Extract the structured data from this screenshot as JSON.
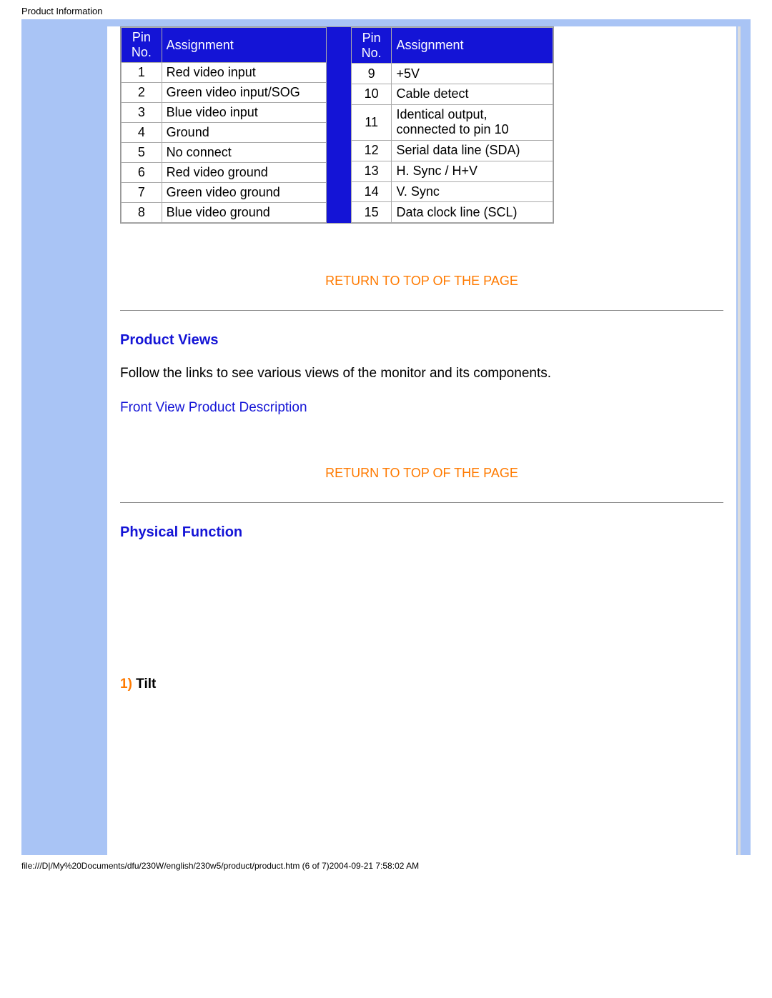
{
  "page_title": "Product Information",
  "table_left": {
    "headers": [
      "Pin No.",
      "Assignment"
    ],
    "rows": [
      {
        "pin": "1",
        "assign": "Red video input"
      },
      {
        "pin": "2",
        "assign": "Green video input/SOG"
      },
      {
        "pin": "3",
        "assign": "Blue video input"
      },
      {
        "pin": "4",
        "assign": "Ground"
      },
      {
        "pin": "5",
        "assign": "No connect"
      },
      {
        "pin": "6",
        "assign": "Red video ground"
      },
      {
        "pin": "7",
        "assign": "Green video ground"
      },
      {
        "pin": "8",
        "assign": "Blue video ground"
      }
    ]
  },
  "table_right": {
    "headers": [
      "Pin No.",
      "Assignment"
    ],
    "rows": [
      {
        "pin": "9",
        "assign": "+5V"
      },
      {
        "pin": "10",
        "assign": "Cable detect"
      },
      {
        "pin": "11",
        "assign": "Identical output, connected to pin 10"
      },
      {
        "pin": "12",
        "assign": "Serial data line (SDA)"
      },
      {
        "pin": "13",
        "assign": "H. Sync / H+V"
      },
      {
        "pin": "14",
        "assign": "V. Sync"
      },
      {
        "pin": "15",
        "assign": "Data clock line (SCL)"
      }
    ]
  },
  "links": {
    "return_top": "RETURN TO TOP OF THE PAGE",
    "front_view": "Front View Product Description"
  },
  "sections": {
    "product_views": "Product Views",
    "product_views_text": "Follow the links to see various views of the monitor and its components.",
    "physical_function": "Physical Function",
    "tilt_num": "1)",
    "tilt_label": " Tilt"
  },
  "footer": "file:///D|/My%20Documents/dfu/230W/english/230w5/product/product.htm (6 of 7)2004-09-21 7:58:02 AM"
}
